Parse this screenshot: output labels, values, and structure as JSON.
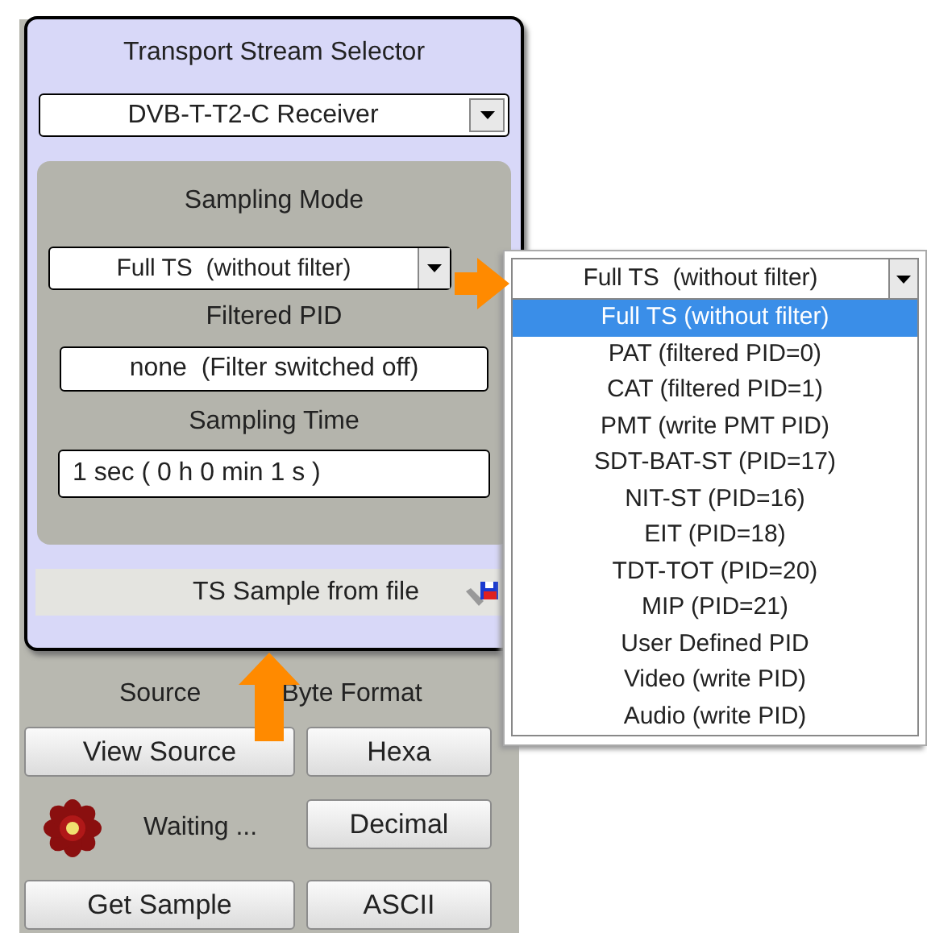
{
  "selector": {
    "title": "Transport Stream Selector",
    "value": "DVB-T-T2-C Receiver"
  },
  "sampling": {
    "mode_label": "Sampling Mode",
    "mode_value": "Full TS  (without filter)",
    "pid_label": "Filtered PID",
    "pid_value": "none  (Filter switched off)",
    "time_label": "Sampling Time",
    "time_value": "1 sec ( 0 h 0 min 1 s )"
  },
  "file_bar": {
    "label": "TS Sample from file"
  },
  "source": {
    "label": "Source",
    "buttons": [
      "View Source",
      "Get Sample"
    ],
    "status": "Waiting ..."
  },
  "byte_format": {
    "label": "Byte Format",
    "buttons": [
      "Hexa",
      "Decimal",
      "ASCII"
    ]
  },
  "mode_dropdown": {
    "value": "Full TS  (without filter)",
    "options": [
      {
        "label": "Full TS (without filter)",
        "selected": true
      },
      {
        "label": "PAT (filtered PID=0)",
        "selected": false
      },
      {
        "label": "CAT (filtered PID=1)",
        "selected": false
      },
      {
        "label": "PMT (write PMT PID)",
        "selected": false
      },
      {
        "label": "SDT-BAT-ST (PID=17)",
        "selected": false
      },
      {
        "label": "NIT-ST (PID=16)",
        "selected": false
      },
      {
        "label": "EIT (PID=18)",
        "selected": false
      },
      {
        "label": "TDT-TOT (PID=20)",
        "selected": false
      },
      {
        "label": "MIP (PID=21)",
        "selected": false
      },
      {
        "label": "User Defined PID",
        "selected": false
      },
      {
        "label": "Video (write PID)",
        "selected": false
      },
      {
        "label": "Audio (write PID)",
        "selected": false
      }
    ]
  }
}
